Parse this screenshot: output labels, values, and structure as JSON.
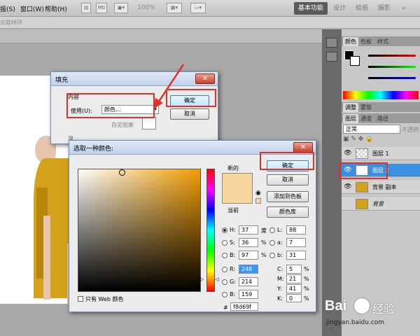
{
  "menubar": {
    "items": [
      "报(S)",
      "窗口(W)",
      "帮助(H)"
    ],
    "zoom": "100%",
    "workspaces": [
      "基本功能",
      "设计",
      "绘画",
      "摄影"
    ]
  },
  "options_bar": {
    "hint": "示取样环"
  },
  "panels": {
    "color_tabs": [
      "颜色",
      "色板",
      "样式"
    ],
    "adjust_tabs": [
      "调整",
      "蒙版"
    ],
    "layer_tabs": [
      "图层",
      "通道",
      "路径"
    ],
    "blend_mode": "正常",
    "opacity_label": "不透明",
    "layers": [
      {
        "name": "图层 1",
        "visible": true,
        "selected": false
      },
      {
        "name": "图层 2",
        "visible": true,
        "selected": true
      },
      {
        "name": "背景 副本",
        "visible": true,
        "selected": false
      },
      {
        "name": "背景",
        "visible": false,
        "selected": false
      }
    ]
  },
  "fill_dialog": {
    "title": "填充",
    "group_label": "内容",
    "use_label": "使用(U):",
    "use_value": "颜色...",
    "custom_pattern_label": "自定图案",
    "ok_label": "确定",
    "cancel_label": "取消",
    "blend_label": "混"
  },
  "picker_dialog": {
    "title": "选取一种颜色:",
    "new_label": "新的",
    "current_label": "当前",
    "ok_label": "确定",
    "cancel_label": "取消",
    "add_swatch_label": "添加到色板",
    "color_library_label": "颜色库",
    "web_only_label": "只有 Web 颜色",
    "H": {
      "label": "H:",
      "value": "37",
      "unit": "度"
    },
    "S": {
      "label": "S:",
      "value": "36",
      "unit": "%"
    },
    "B": {
      "label": "B:",
      "value": "97",
      "unit": "%"
    },
    "R": {
      "label": "R:",
      "value": "248"
    },
    "G": {
      "label": "G:",
      "value": "214"
    },
    "Bc": {
      "label": "B:",
      "value": "159"
    },
    "L": {
      "label": "L:",
      "value": "88"
    },
    "a": {
      "label": "a:",
      "value": "7"
    },
    "b": {
      "label": "b:",
      "value": "31"
    },
    "C": {
      "label": "C:",
      "value": "5",
      "unit": "%"
    },
    "M": {
      "label": "M:",
      "value": "21",
      "unit": "%"
    },
    "Y": {
      "label": "Y:",
      "value": "41",
      "unit": "%"
    },
    "K": {
      "label": "K:",
      "value": "0",
      "unit": "%"
    },
    "hex_label": "#",
    "hex": "f8d69f",
    "new_color": "#f8d69f",
    "current_color": "#f8d69f"
  },
  "watermark": {
    "brand": "Bai",
    "brand_cn": "经验",
    "url": "jingyan.baidu.com"
  },
  "colors": {
    "annotation_red": "#e0302a",
    "selection_blue": "#3b8fe0"
  }
}
